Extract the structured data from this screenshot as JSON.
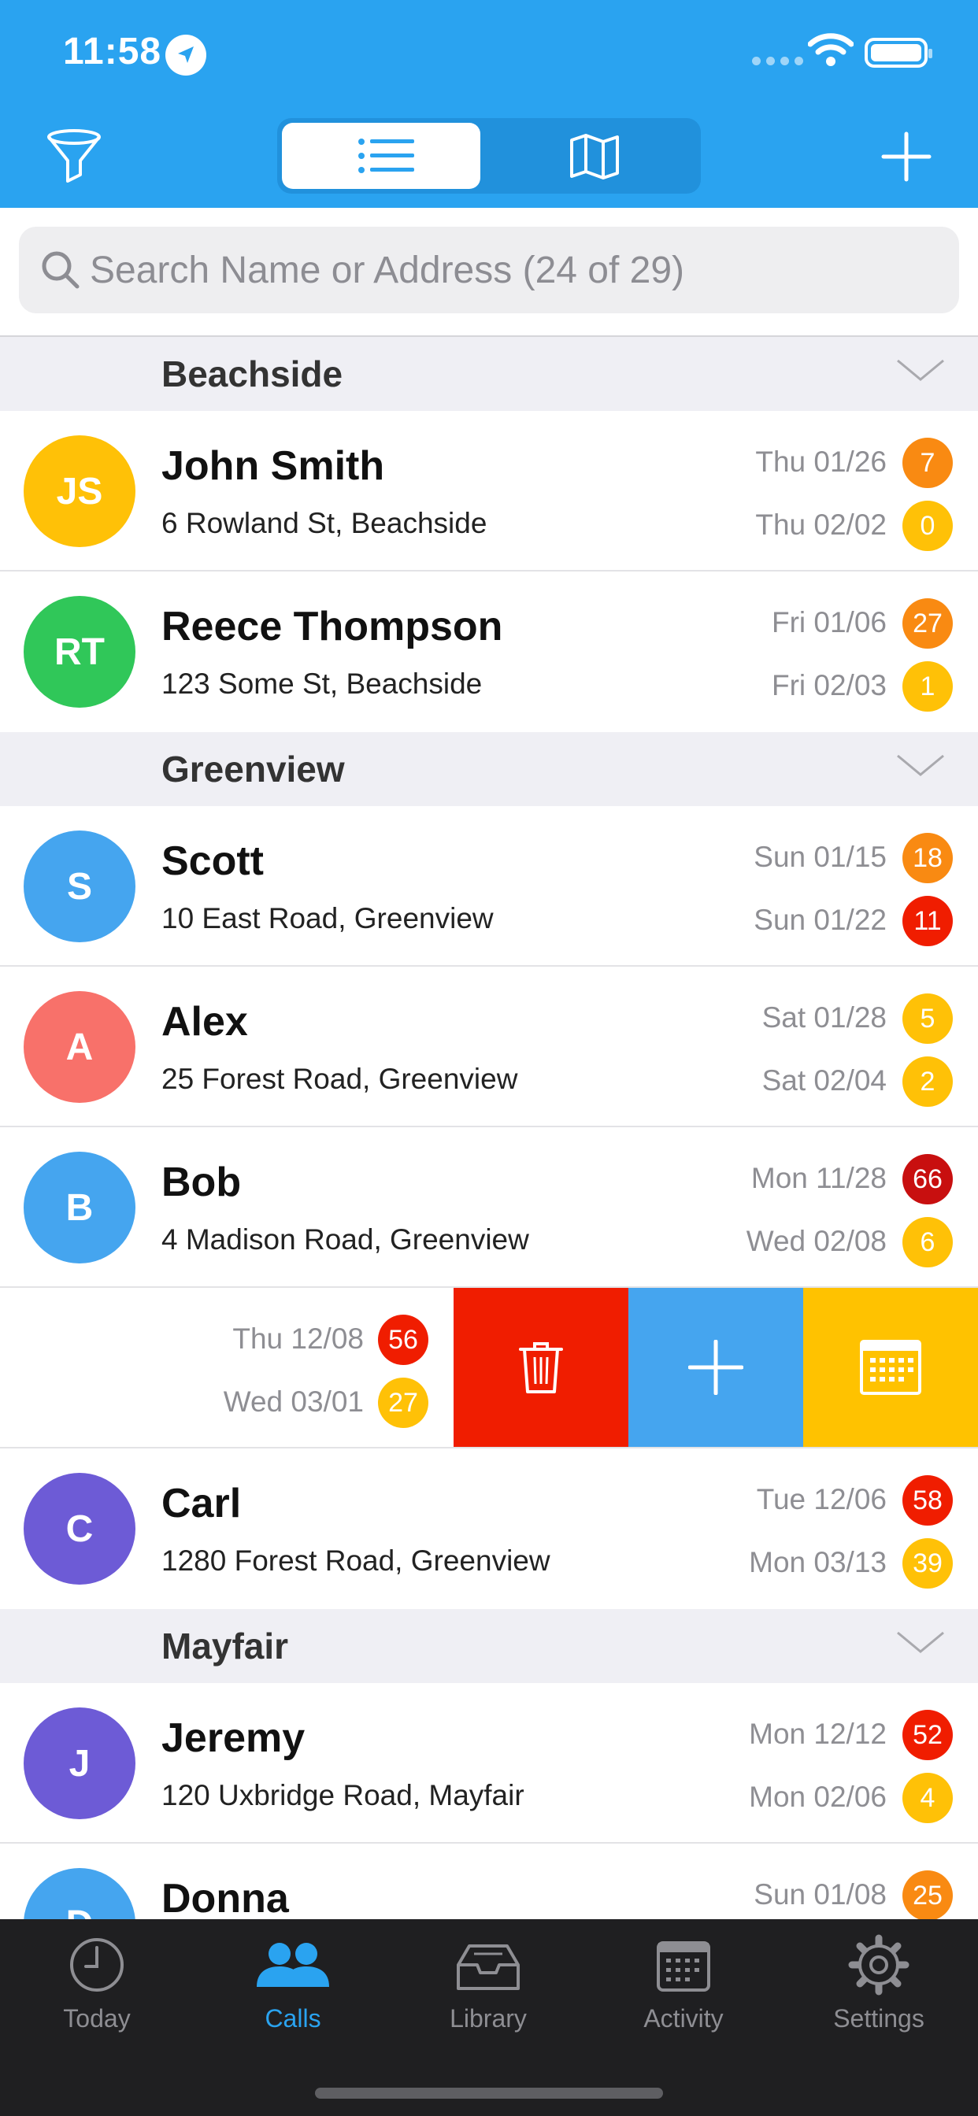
{
  "status_bar": {
    "time": "11:58",
    "location_icon": "location-arrow-icon",
    "wifi_icon": "wifi-icon",
    "battery_icon": "battery-icon"
  },
  "toolbar": {
    "filter_icon": "funnel-icon",
    "segments": [
      {
        "icon": "list-icon",
        "selected": true
      },
      {
        "icon": "map-icon",
        "selected": false
      }
    ],
    "add_icon": "plus-icon"
  },
  "search": {
    "placeholder": "Search Name or Address (24 of 29)",
    "value": ""
  },
  "colors": {
    "accent": "#2aa3f0",
    "orange": "#f98a12",
    "yellow": "#ffc107",
    "red": "#f01d00",
    "dark_red": "#c80f0f"
  },
  "sections": [
    {
      "title": "Beachside",
      "rows": [
        {
          "initials": "JS",
          "avatar_color": "#ffc107",
          "name": "John Smith",
          "address": "6 Rowland St, Beachside",
          "date1": "Thu 01/26",
          "badge1": "7",
          "badge1_color": "#f98a12",
          "date2": "Thu 02/02",
          "badge2": "0",
          "badge2_color": "#ffc107"
        },
        {
          "initials": "RT",
          "avatar_color": "#30c759",
          "name": "Reece Thompson",
          "address": "123 Some St, Beachside",
          "date1": "Fri 01/06",
          "badge1": "27",
          "badge1_color": "#f98a12",
          "date2": "Fri 02/03",
          "badge2": "1",
          "badge2_color": "#ffc107"
        }
      ]
    },
    {
      "title": "Greenview",
      "rows": [
        {
          "initials": "S",
          "avatar_color": "#45a5ef",
          "name": "Scott",
          "address": "10 East Road, Greenview",
          "date1": "Sun 01/15",
          "badge1": "18",
          "badge1_color": "#f98a12",
          "date2": "Sun 01/22",
          "badge2": "11",
          "badge2_color": "#f01d00"
        },
        {
          "initials": "A",
          "avatar_color": "#f8716a",
          "name": "Alex",
          "address": "25 Forest Road, Greenview",
          "date1": "Sat 01/28",
          "badge1": "5",
          "badge1_color": "#ffc107",
          "date2": "Sat 02/04",
          "badge2": "2",
          "badge2_color": "#ffc107"
        },
        {
          "initials": "B",
          "avatar_color": "#45a5ef",
          "name": "Bob",
          "address": "4 Madison Road, Greenview",
          "date1": "Mon 11/28",
          "badge1": "66",
          "badge1_color": "#c80f0f",
          "date2": "Wed 02/08",
          "badge2": "6",
          "badge2_color": "#ffc107"
        }
      ],
      "swiped_row": {
        "date1": "Thu 12/08",
        "badge1": "56",
        "badge1_color": "#f01d00",
        "date2": "Wed 03/01",
        "badge2": "27",
        "badge2_color": "#ffc107",
        "actions": [
          {
            "icon": "trash-icon",
            "color": "#f01d00"
          },
          {
            "icon": "plus-icon",
            "color": "#45a5ef"
          },
          {
            "icon": "calendar-icon",
            "color": "#ffc200"
          }
        ]
      },
      "rows_after": [
        {
          "initials": "C",
          "avatar_color": "#6d5bd6",
          "name": "Carl",
          "address": "1280 Forest Road, Greenview",
          "date1": "Tue 12/06",
          "badge1": "58",
          "badge1_color": "#f01d00",
          "date2": "Mon 03/13",
          "badge2": "39",
          "badge2_color": "#ffc107"
        }
      ]
    },
    {
      "title": "Mayfair",
      "rows": [
        {
          "initials": "J",
          "avatar_color": "#6d5bd6",
          "name": "Jeremy",
          "address": "120 Uxbridge Road, Mayfair",
          "date1": "Mon 12/12",
          "badge1": "52",
          "badge1_color": "#f01d00",
          "date2": "Mon 02/06",
          "badge2": "4",
          "badge2_color": "#ffc107"
        },
        {
          "initials": "D",
          "avatar_color": "#45a5ef",
          "name": "Donna",
          "address": "",
          "date1": "Sun 01/08",
          "badge1": "25",
          "badge1_color": "#f98a12",
          "date2": "",
          "badge2": "",
          "badge2_color": ""
        }
      ]
    }
  ],
  "tabbar": {
    "tabs": [
      {
        "label": "Today",
        "icon": "clock-icon",
        "active": false
      },
      {
        "label": "Calls",
        "icon": "people-icon",
        "active": true
      },
      {
        "label": "Library",
        "icon": "tray-icon",
        "active": false
      },
      {
        "label": "Activity",
        "icon": "calendar-icon",
        "active": false
      },
      {
        "label": "Settings",
        "icon": "gear-icon",
        "active": false
      }
    ]
  }
}
